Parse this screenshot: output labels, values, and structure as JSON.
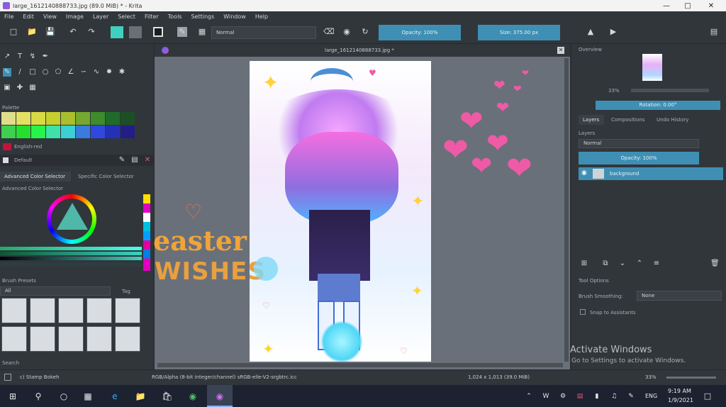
{
  "window": {
    "title": "large_1612140888733.jpg (89.0 MiB)  * - Krita",
    "controls": [
      "minimize-icon",
      "maximize-icon",
      "close-icon"
    ]
  },
  "menu": [
    "File",
    "Edit",
    "View",
    "Image",
    "Layer",
    "Select",
    "Filter",
    "Tools",
    "Settings",
    "Window",
    "Help"
  ],
  "toolbar": {
    "blend_mode": "Normal",
    "opacity_label": "Opacity: 100%",
    "size_label": "Size: 375.00 px",
    "colors": {
      "foreground": "#3fd0c0",
      "background": "#6a6f75",
      "accent": "#3f8fb4"
    }
  },
  "left_panel": {
    "palette_title": "Palette",
    "palette_colors": [
      "#dede8a",
      "#e3e062",
      "#d8da44",
      "#c7cf2d",
      "#a9c02c",
      "#74a82e",
      "#3e8c2c",
      "#1f6b2a",
      "#1c4f26",
      "#3fd04d",
      "#24e02c",
      "#27f44b",
      "#3ee2a8",
      "#3ad0d6",
      "#3a7bde",
      "#2f48e0",
      "#2530b8",
      "#231d88"
    ],
    "palette_name": "English-red",
    "resource_name": "Default",
    "tabs": [
      "Advanced Color Selector",
      "Specific Color Selector"
    ],
    "color_selector_title": "Advanced Color Selector",
    "brush_presets_title": "Brush Presets",
    "brush_filter": "All",
    "brush_tag": "Tag",
    "search_label": "Search"
  },
  "document": {
    "tab_title": "large_1612140888733.jpg *",
    "overlay_text": {
      "line1": "easter",
      "line2": "WISHES"
    }
  },
  "right_panel": {
    "overview_title": "Overview",
    "zoom_value": "33%",
    "rotation_label": "Rotation: 0.00°",
    "tabs": [
      "Layers",
      "Compositions",
      "Undo History"
    ],
    "layers_title": "Layers",
    "layer_blend": "Normal",
    "layer_opacity": "Opacity: 100%",
    "layer_name": "background",
    "tool_options_title": "Tool Options",
    "brush_smoothing_label": "Brush Smoothing:",
    "brush_smoothing_value": "None",
    "snap_label": "Snap to Assistants"
  },
  "statusbar": {
    "brush_name": "c) Stamp Bokeh",
    "color_space": "RGB/Alpha (8-bit integer/channel)  sRGB-elle-V2-srgbtrc.icc",
    "dimensions": "1,024 x 1,013 (39.0 MiB)",
    "zoom": "33%"
  },
  "activation": {
    "title": "Activate Windows",
    "subtitle": "Go to Settings to activate Windows."
  },
  "taskbar": {
    "time": "9:19 AM",
    "date": "1/9/2021",
    "lang": "ENG"
  }
}
